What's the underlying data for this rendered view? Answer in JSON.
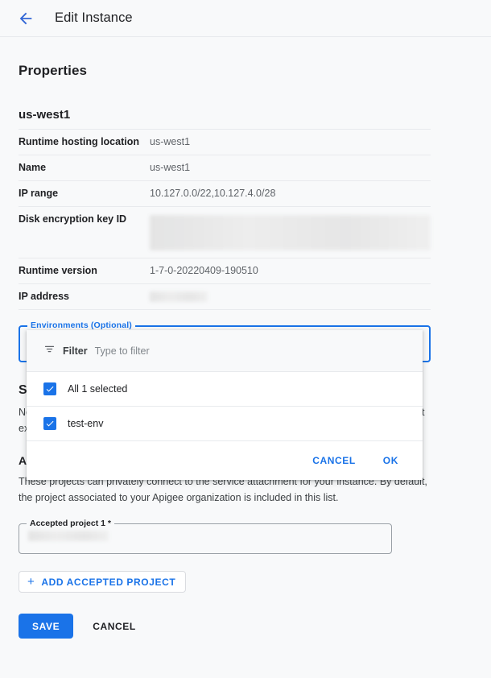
{
  "appbar": {
    "back_icon": "arrow-back-icon",
    "title": "Edit Instance"
  },
  "page": {
    "section_title": "Properties",
    "instance_name": "us-west1"
  },
  "properties_table": {
    "rows": [
      {
        "key": "Runtime hosting location",
        "value": "us-west1",
        "redacted": false
      },
      {
        "key": "Name",
        "value": "us-west1",
        "redacted": false
      },
      {
        "key": "IP range",
        "value": "10.127.0.0/22,10.127.4.0/28",
        "redacted": false
      },
      {
        "key": "Disk encryption key ID",
        "value": "",
        "redacted": true
      },
      {
        "key": "Runtime version",
        "value": "1-7-0-20220409-190510",
        "redacted": false
      },
      {
        "key": "IP address",
        "value": "",
        "redacted": true
      }
    ]
  },
  "environments_field": {
    "label": "Environments (Optional)",
    "value": "",
    "focused": true
  },
  "service_attachment": {
    "heading": "Service attachment",
    "body": "Network endpoints in the projects listed below can privately connect to this instance without exposing traffic over the public internet."
  },
  "accepted_projects": {
    "heading": "Accepted projects",
    "body": "These projects can privately connect to the service attachment for your instance. By default, the project associated to your Apigee organization is included in this list.",
    "field_label": "Accepted project 1 *",
    "field_value": "",
    "add_button_label": "ADD ACCEPTED PROJECT",
    "add_button_icon": "plus-icon"
  },
  "form_actions": {
    "save_label": "SAVE",
    "cancel_label": "CANCEL"
  },
  "dropdown": {
    "filter_icon": "filter-icon",
    "filter_label": "Filter",
    "filter_placeholder": "Type to filter",
    "filter_value": "",
    "options": [
      {
        "label": "All 1 selected",
        "checked": true
      },
      {
        "label": "test-env",
        "checked": true
      }
    ],
    "cancel_label": "CANCEL",
    "ok_label": "OK"
  },
  "colors": {
    "accent": "#1a73e8",
    "page_background": "#f8f9fa",
    "panel_background": "#ffffff",
    "divider": "#e8eaed",
    "text_primary": "#202124",
    "text_secondary": "#5f6368"
  }
}
